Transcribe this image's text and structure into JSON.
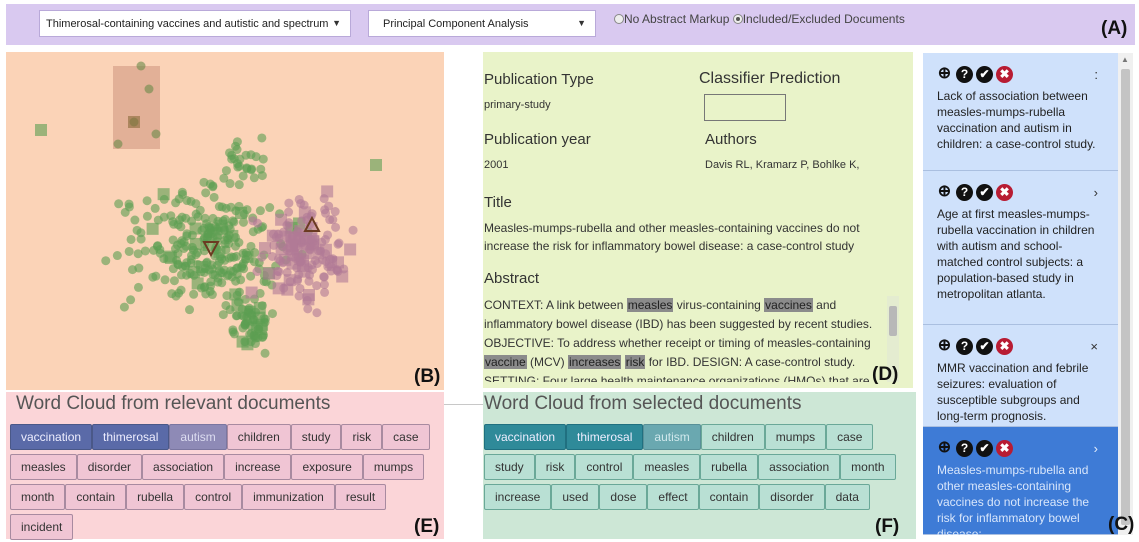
{
  "controls": {
    "topic": "Thimerosal-containing vaccines and autistic and spectrum",
    "method": "Principal Component Analysis",
    "radio1": "No Abstract Markup",
    "radio2": "Included/Excluded Documents",
    "radio_selected": "Included/Excluded Documents",
    "caret": "▼"
  },
  "labels": {
    "A": "(A)",
    "B": "(B)",
    "C": "(C)",
    "D": "(D)",
    "E": "(E)",
    "F": "(F)"
  },
  "details": {
    "pub_type_label": "Publication Type",
    "pub_type": "primary-study",
    "prediction_label": "Classifier Prediction",
    "year_label": "Publication year",
    "year": "2001",
    "authors_label": "Authors",
    "authors": "Davis RL, Kramarz P, Bohlke K,",
    "title_label": "Title",
    "title": "Measles-mumps-rubella and other measles-containing vaccines do not increase the risk for inflammatory bowel disease: a case-control study",
    "abstract_label": "Abstract",
    "abstract_parts": [
      {
        "t": "CONTEXT: A link between ",
        "hl": false
      },
      {
        "t": "measles",
        "hl": true
      },
      {
        "t": " virus-containing ",
        "hl": false
      },
      {
        "t": "vaccines",
        "hl": true
      },
      {
        "t": " and inflammatory bowel disease (IBD) has been suggested by recent studies. OBJECTIVE: To address whether receipt or timing of measles-containing ",
        "hl": false
      },
      {
        "t": "vaccine",
        "hl": true
      },
      {
        "t": " (MCV) ",
        "hl": false
      },
      {
        "t": "increases",
        "hl": true
      },
      {
        "t": " ",
        "hl": false
      },
      {
        "t": "risk",
        "hl": true
      },
      {
        "t": " for IBD. DESIGN: A case-control study. SETTING: Four large health maintenance organizations (HMOs) that are",
        "hl": false
      }
    ]
  },
  "documents": [
    {
      "title": "Lack of association between measles-mumps-rubella vaccination and autism in children: a case-control study.",
      "arrow": ":",
      "selected": false
    },
    {
      "title": "Age at first measles-mumps-rubella vaccination in children with autism and school-matched control subjects: a population-based study in metropolitan atlanta.",
      "arrow": "›",
      "selected": false
    },
    {
      "title": "MMR vaccination and febrile seizures: evaluation of susceptible subgroups and long-term prognosis.",
      "arrow": "×",
      "selected": false
    },
    {
      "title": "Measles-mumps-rubella and other measles-containing vaccines do not increase the risk for inflammatory bowel disease:",
      "arrow": "›",
      "selected": true
    }
  ],
  "doc_icons": {
    "zoom": "⊕",
    "question": "?",
    "check": "✔",
    "cross": "✖"
  },
  "wordcloud_relevant": {
    "title": "Word Cloud from relevant documents",
    "words": [
      {
        "w": "vaccination",
        "tier": 1
      },
      {
        "w": "thimerosal",
        "tier": 1
      },
      {
        "w": "autism",
        "tier": 2
      },
      {
        "w": "children",
        "tier": 0
      },
      {
        "w": "study",
        "tier": 0
      },
      {
        "w": "risk",
        "tier": 0
      },
      {
        "w": "case",
        "tier": 0
      },
      {
        "w": "measles",
        "tier": 0
      },
      {
        "w": "disorder",
        "tier": 0
      },
      {
        "w": "association",
        "tier": 0
      },
      {
        "w": "increase",
        "tier": 0
      },
      {
        "w": "exposure",
        "tier": 0
      },
      {
        "w": "mumps",
        "tier": 0
      },
      {
        "w": "month",
        "tier": 0
      },
      {
        "w": "contain",
        "tier": 0
      },
      {
        "w": "rubella",
        "tier": 0
      },
      {
        "w": "control",
        "tier": 0
      },
      {
        "w": "immunization",
        "tier": 0
      },
      {
        "w": "result",
        "tier": 0
      },
      {
        "w": "incident",
        "tier": 0
      }
    ]
  },
  "wordcloud_selected": {
    "title": "Word Cloud from selected documents",
    "words": [
      {
        "w": "vaccination",
        "tier": 1
      },
      {
        "w": "thimerosal",
        "tier": 1
      },
      {
        "w": "autism",
        "tier": 2
      },
      {
        "w": "children",
        "tier": 0
      },
      {
        "w": "mumps",
        "tier": 0
      },
      {
        "w": "case",
        "tier": 0
      },
      {
        "w": "study",
        "tier": 0
      },
      {
        "w": "risk",
        "tier": 0
      },
      {
        "w": "control",
        "tier": 0
      },
      {
        "w": "measles",
        "tier": 0
      },
      {
        "w": "rubella",
        "tier": 0
      },
      {
        "w": "association",
        "tier": 0
      },
      {
        "w": "month",
        "tier": 0
      },
      {
        "w": "increase",
        "tier": 0
      },
      {
        "w": "used",
        "tier": 0
      },
      {
        "w": "dose",
        "tier": 0
      },
      {
        "w": "effect",
        "tier": 0
      },
      {
        "w": "contain",
        "tier": 0
      },
      {
        "w": "disorder",
        "tier": 0
      },
      {
        "w": "data",
        "tier": 0
      }
    ]
  },
  "colors": {
    "included": "#5c9e52",
    "excluded": "#b07a96",
    "selected_doc": "#3e7bd6",
    "marker_outline": "#6b3b22"
  }
}
